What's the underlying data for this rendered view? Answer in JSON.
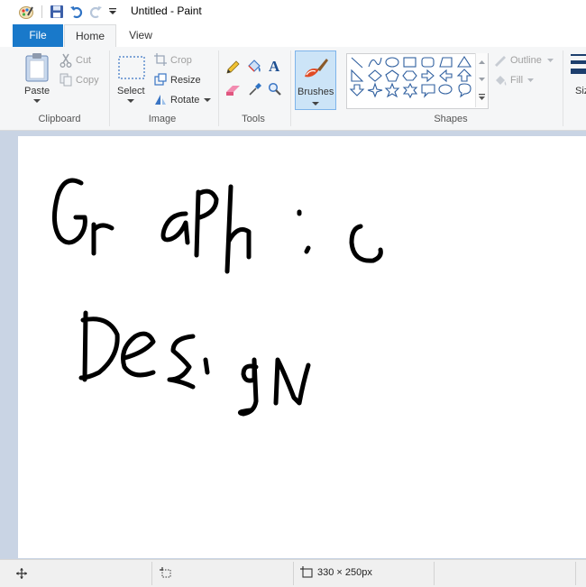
{
  "window": {
    "title": "Untitled - Paint"
  },
  "tabs": [
    {
      "label": "File"
    },
    {
      "label": "Home"
    },
    {
      "label": "View"
    }
  ],
  "ribbon": {
    "clipboard": {
      "label": "Clipboard",
      "paste": "Paste",
      "cut": "Cut",
      "copy": "Copy"
    },
    "image": {
      "label": "Image",
      "select": "Select",
      "crop": "Crop",
      "resize": "Resize",
      "rotate": "Rotate"
    },
    "tools": {
      "label": "Tools"
    },
    "brushes": {
      "label": "Brushes"
    },
    "shapes": {
      "label": "Shapes",
      "outline": "Outline",
      "fill": "Fill"
    },
    "size": {
      "label": "Siz"
    }
  },
  "canvas": {
    "drawing_text": [
      "Graphic",
      "Design"
    ]
  },
  "status": {
    "image_size": "330 × 250px"
  },
  "colors": {
    "accent": "#1979ca",
    "workspace": "#c9d4e4"
  }
}
